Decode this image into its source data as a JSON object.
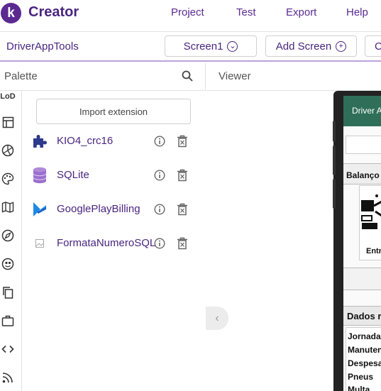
{
  "app": {
    "logo_letter": "k",
    "name": "Creator"
  },
  "topmenu": [
    "Project",
    "Test",
    "Export",
    "Help"
  ],
  "project": {
    "name": "DriverAppTools",
    "screen_select": "Screen1",
    "add_screen": "Add Screen",
    "cut_button_letter": "C"
  },
  "palette": {
    "title": "Palette",
    "import_label": "Import extension",
    "extensions": [
      {
        "label": "KIO4_crc16",
        "icon": "puzzle-icon"
      },
      {
        "label": "SQLite",
        "icon": "database-icon"
      },
      {
        "label": "GooglePlayBilling",
        "icon": "google-play-billing-icon"
      },
      {
        "label": "FormataNumeroSQL",
        "icon": "image-placeholder-icon"
      }
    ]
  },
  "rail_icons": [
    "layout-icon",
    "table-icon",
    "media-icon",
    "palette-icon",
    "map-icon",
    "compass-icon",
    "sensor-icon",
    "copy-icon",
    "briefcase-icon",
    "code-icon",
    "rss-icon"
  ],
  "rail_top_label": "LoD",
  "viewer": {
    "title": "Viewer",
    "phone": {
      "title": "Driver A",
      "balanco": "Balanço",
      "entr_label": "Entr",
      "dados": "Dados r",
      "items": [
        "Jornada",
        "Manuten",
        "Despesa",
        "Pneus",
        "Multa"
      ]
    }
  },
  "colors": {
    "brand": "#5b2a91",
    "appbar": "#2f6f5a"
  }
}
